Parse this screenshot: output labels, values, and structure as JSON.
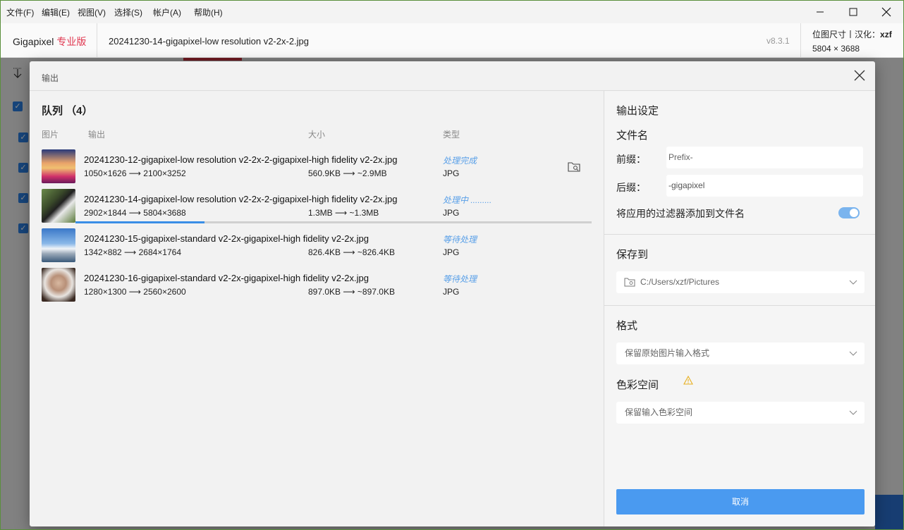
{
  "menu": [
    "文件(F)",
    "编辑(E)",
    "视图(V)",
    "选择(S)",
    "帐户(A)",
    "帮助(H)"
  ],
  "app": {
    "brand": "Gigapixel",
    "edition": "专业版",
    "current_file": "20241230-14-gigapixel-low resolution v2-2x-2.jpg",
    "version": "v8.3.1",
    "size_label": "位图尺寸丨汉化：",
    "size_author": "xzf",
    "size_value": "5804 × 3688"
  },
  "dialog": {
    "title": "输出",
    "queue": {
      "title": "队列 （4）",
      "columns": {
        "image": "图片",
        "output": "输出",
        "size": "大小",
        "type": "类型"
      },
      "items": [
        {
          "name": "20241230-12-gigapixel-low resolution v2-2x-2-gigapixel-high fidelity v2-2x.jpg",
          "dims": "1050×1626 ⟶ 2100×3252",
          "size": "560.9KB ⟶ ~2.9MB",
          "status": "处理完成",
          "type": "JPG"
        },
        {
          "name": "20241230-14-gigapixel-low resolution v2-2x-2-gigapixel-high fidelity v2-2x.jpg",
          "dims": "2902×1844 ⟶ 5804×3688",
          "size": "1.3MB ⟶ ~1.3MB",
          "status": "处理中 .........",
          "type": "JPG",
          "progress": 0.25
        },
        {
          "name": "20241230-15-gigapixel-standard v2-2x-gigapixel-high fidelity v2-2x.jpg",
          "dims": "1342×882 ⟶ 2684×1764",
          "size": "826.4KB ⟶ ~826.4KB",
          "status": "等待处理",
          "type": "JPG"
        },
        {
          "name": "20241230-16-gigapixel-standard v2-2x-gigapixel-high fidelity v2-2x.jpg",
          "dims": "1280×1300 ⟶ 2560×2600",
          "size": "897.0KB ⟶ ~897.0KB",
          "status": "等待处理",
          "type": "JPG"
        }
      ]
    },
    "settings": {
      "title": "输出设定",
      "filename_heading": "文件名",
      "prefix_label": "前缀：",
      "prefix_placeholder": "Prefix-",
      "suffix_label": "后缀：",
      "suffix_value": "-gigapixel",
      "append_filter_label": "将应用的过滤器添加到文件名",
      "append_filter_on": true,
      "save_to_heading": "保存到",
      "save_path": "C:/Users/xzf/Pictures",
      "format_heading": "格式",
      "format_value": "保留原始图片输入格式",
      "colorspace_heading": "色彩空间",
      "colorspace_value": "保留输入色彩空间",
      "cancel_label": "取消"
    }
  },
  "colors": {
    "accent": "#4a9af0",
    "status": "#5aa0e8",
    "brand_pro": "#e0364f"
  }
}
